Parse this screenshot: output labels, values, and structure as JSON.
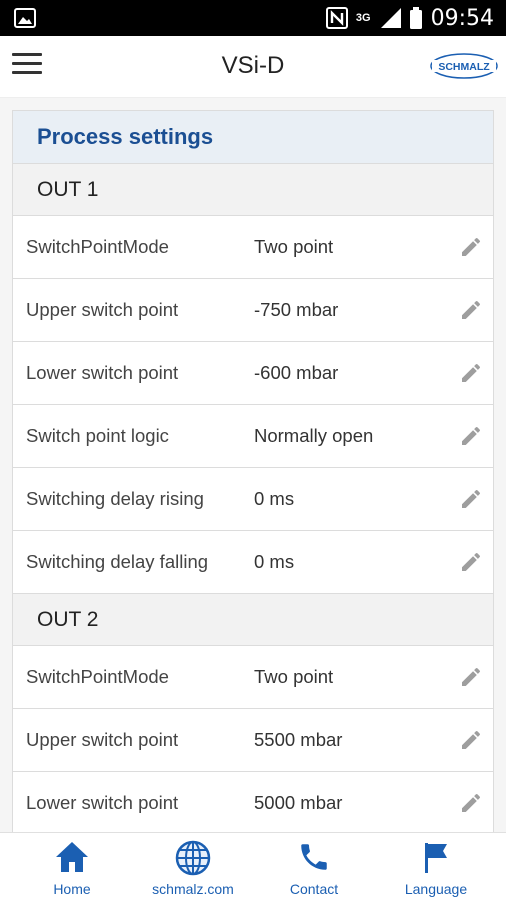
{
  "status_bar": {
    "time": "09:54",
    "network": "3G",
    "icons": [
      "image-icon",
      "nfc-icon",
      "signal-icon",
      "battery-icon"
    ]
  },
  "app_bar": {
    "title": "VSi-D",
    "logo_text": "SCHMALZ",
    "menu_icon": "hamburger-menu-icon"
  },
  "process_settings": {
    "title": "Process settings",
    "groups": [
      {
        "name": "OUT 1",
        "rows": [
          {
            "label": "SwitchPointMode",
            "value": "Two point"
          },
          {
            "label": "Upper switch point",
            "value": "-750 mbar"
          },
          {
            "label": "Lower switch point",
            "value": "-600 mbar"
          },
          {
            "label": "Switch point logic",
            "value": "Normally open"
          },
          {
            "label": "Switching delay rising",
            "value": "0 ms"
          },
          {
            "label": "Switching delay falling",
            "value": "0 ms"
          }
        ]
      },
      {
        "name": "OUT 2",
        "rows": [
          {
            "label": "SwitchPointMode",
            "value": "Two point"
          },
          {
            "label": "Upper switch point",
            "value": "5500 mbar"
          },
          {
            "label": "Lower switch point",
            "value": "5000 mbar"
          }
        ]
      }
    ]
  },
  "bottom_nav": {
    "items": [
      {
        "label": "Home",
        "icon": "home-icon"
      },
      {
        "label": "schmalz.com",
        "icon": "globe-icon"
      },
      {
        "label": "Contact",
        "icon": "phone-icon"
      },
      {
        "label": "Language",
        "icon": "flag-icon"
      }
    ]
  },
  "colors": {
    "accent": "#1b5fb2",
    "header_text": "#1b4f93",
    "header_bg": "#e9eff5",
    "status_bar": "#000000"
  }
}
